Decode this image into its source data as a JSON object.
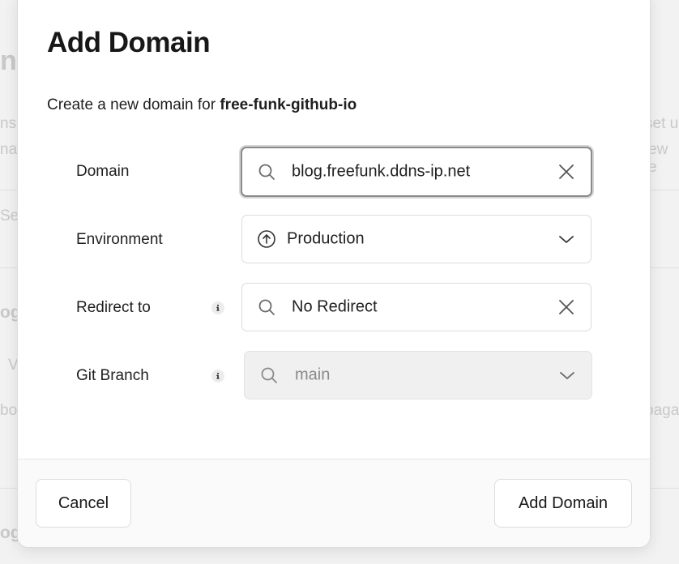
{
  "background": {
    "fragments": [
      "na",
      "ns",
      "na",
      "Sea",
      "og.",
      "V",
      "boo",
      "og.",
      "set u",
      "ew e",
      "paga"
    ]
  },
  "modal": {
    "title": "Add Domain",
    "description_prefix": "Create a new domain for ",
    "project_name": "free-funk-github-io",
    "fields": {
      "domain": {
        "label": "Domain",
        "value": "blog.freefunk.ddns-ip.net",
        "lead_icon": "search-icon",
        "trail_icon": "close-icon"
      },
      "environment": {
        "label": "Environment",
        "value": "Production",
        "lead_icon": "arrow-up-circle-icon",
        "trail_icon": "chevron-down-icon"
      },
      "redirect": {
        "label": "Redirect to",
        "value": "No Redirect",
        "info_icon": "info-icon",
        "lead_icon": "search-icon",
        "trail_icon": "close-icon"
      },
      "git_branch": {
        "label": "Git Branch",
        "value": "main",
        "info_icon": "info-icon",
        "lead_icon": "search-icon",
        "trail_icon": "chevron-down-icon"
      }
    },
    "footer": {
      "cancel_label": "Cancel",
      "submit_label": "Add Domain"
    }
  },
  "colors": {
    "text": "#171717",
    "border": "#dcdcdc",
    "focus_border": "#8a8a8a",
    "disabled_bg": "#f0f0f0",
    "overlay_bg": "#ececec"
  }
}
